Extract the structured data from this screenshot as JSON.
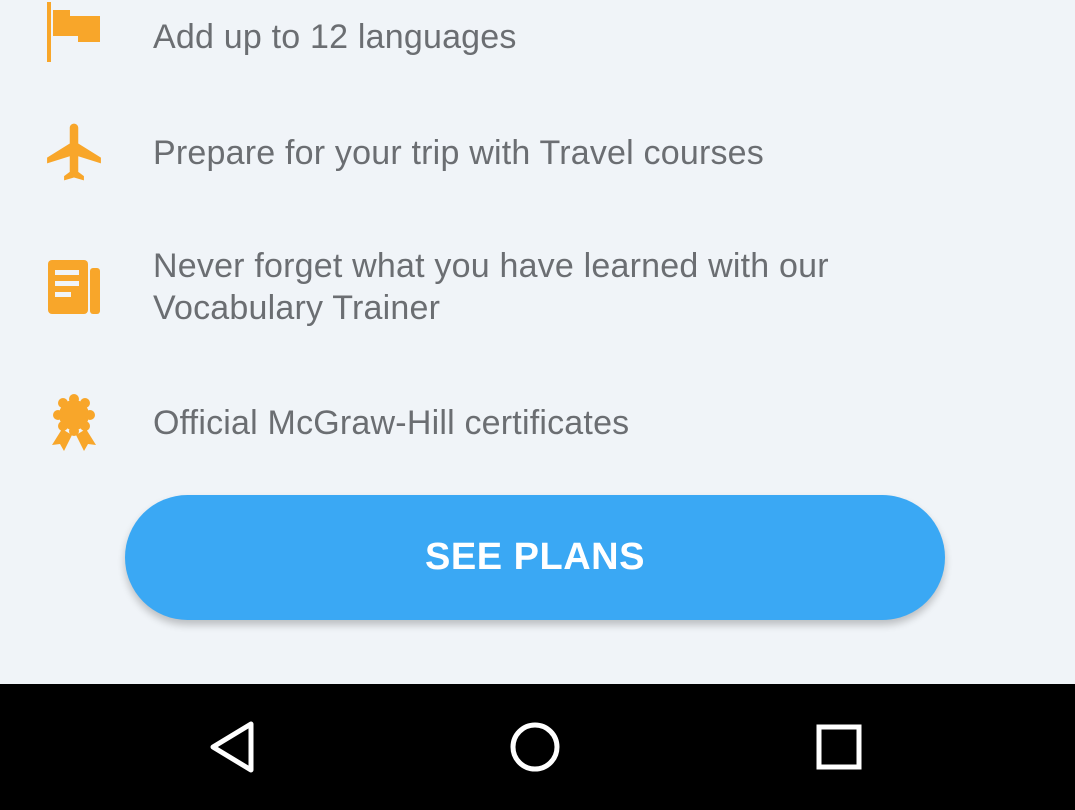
{
  "features": [
    {
      "icon": "flag-icon",
      "text": "Add up to 12 languages"
    },
    {
      "icon": "airplane-icon",
      "text": "Prepare for your trip with Travel courses"
    },
    {
      "icon": "vocabulary-book-icon",
      "text": "Never forget what you have learned with our Vocabulary Trainer"
    },
    {
      "icon": "certificate-badge-icon",
      "text": "Official McGraw-Hill certificates"
    }
  ],
  "cta": {
    "label": "SEE PLANS"
  },
  "navbar": {
    "back": "back-triangle-icon",
    "home": "home-circle-icon",
    "recents": "recents-square-icon"
  },
  "colors": {
    "background": "#f0f4f8",
    "icon_accent": "#f8a62a",
    "text": "#6b6e72",
    "button": "#3aa8f4",
    "navbar": "#000000"
  }
}
